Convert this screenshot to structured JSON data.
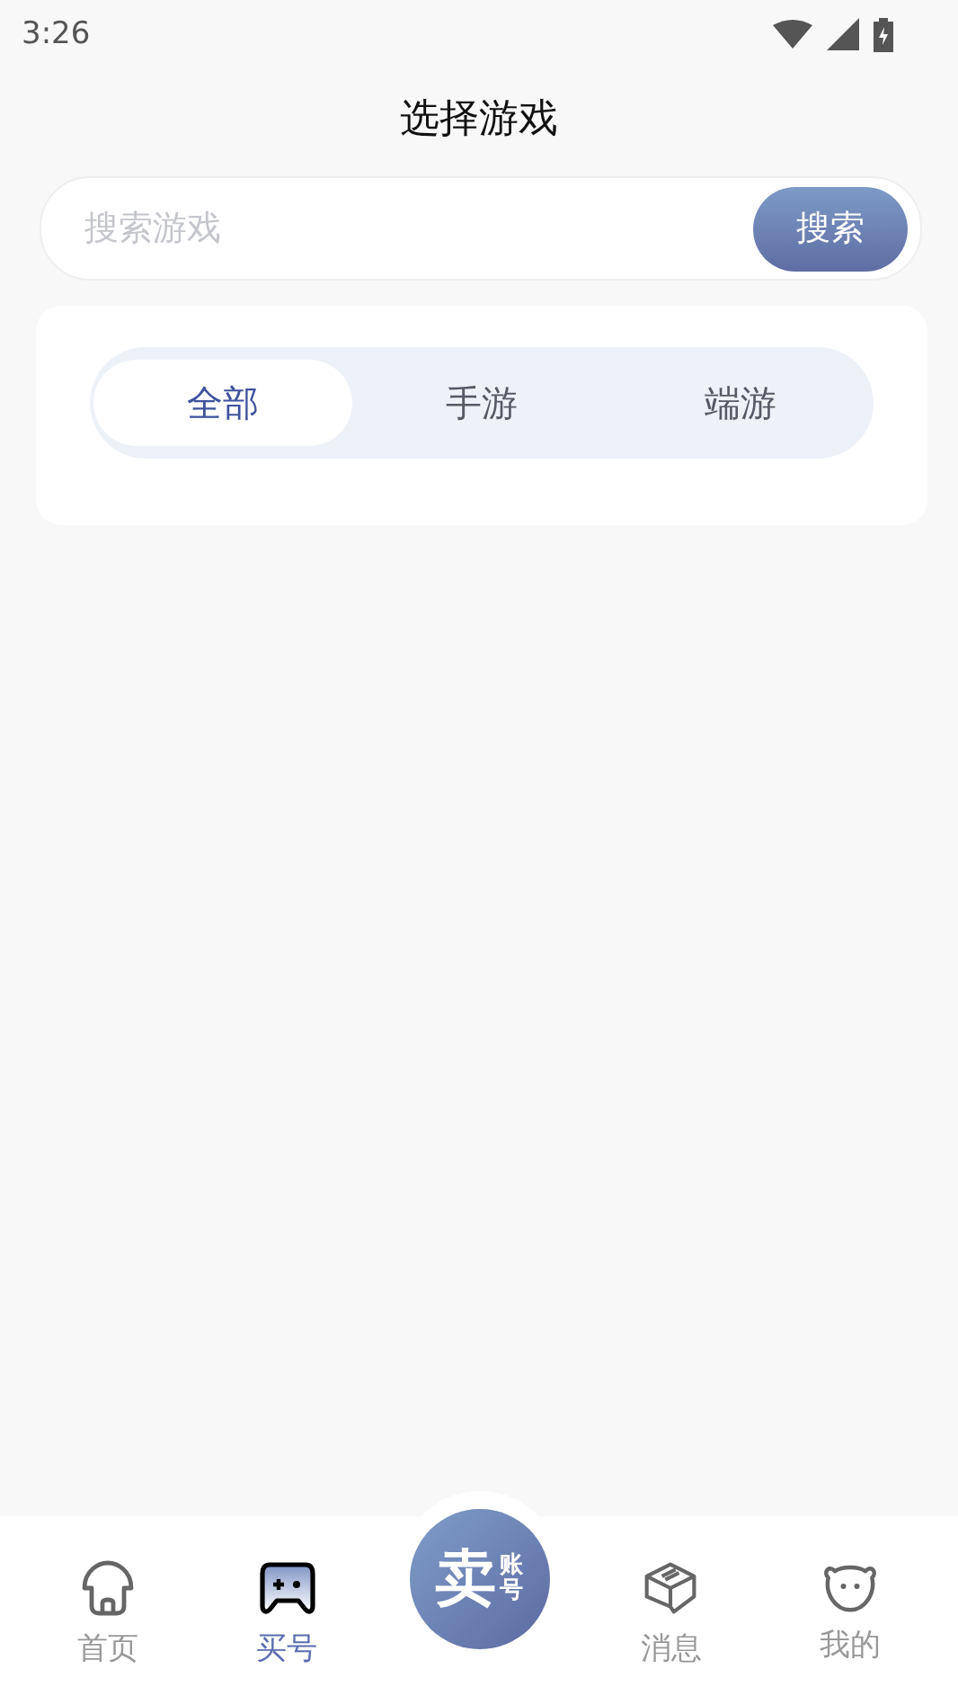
{
  "status_bar": {
    "time": "3:26"
  },
  "header": {
    "title": "选择游戏"
  },
  "search": {
    "placeholder": "搜索游戏",
    "button": "搜索"
  },
  "filter_tabs": [
    {
      "label": "全部",
      "selected": true
    },
    {
      "label": "手游",
      "selected": false
    },
    {
      "label": "端游",
      "selected": false
    }
  ],
  "bottom_nav": [
    {
      "kind": "tab",
      "label": "首页",
      "selected": false
    },
    {
      "kind": "tab",
      "label": "买号",
      "selected": true
    },
    {
      "kind": "sell",
      "main": "卖",
      "side": "账号"
    },
    {
      "kind": "tab",
      "label": "消息",
      "selected": false
    },
    {
      "kind": "tab",
      "label": "我的",
      "selected": false
    }
  ]
}
